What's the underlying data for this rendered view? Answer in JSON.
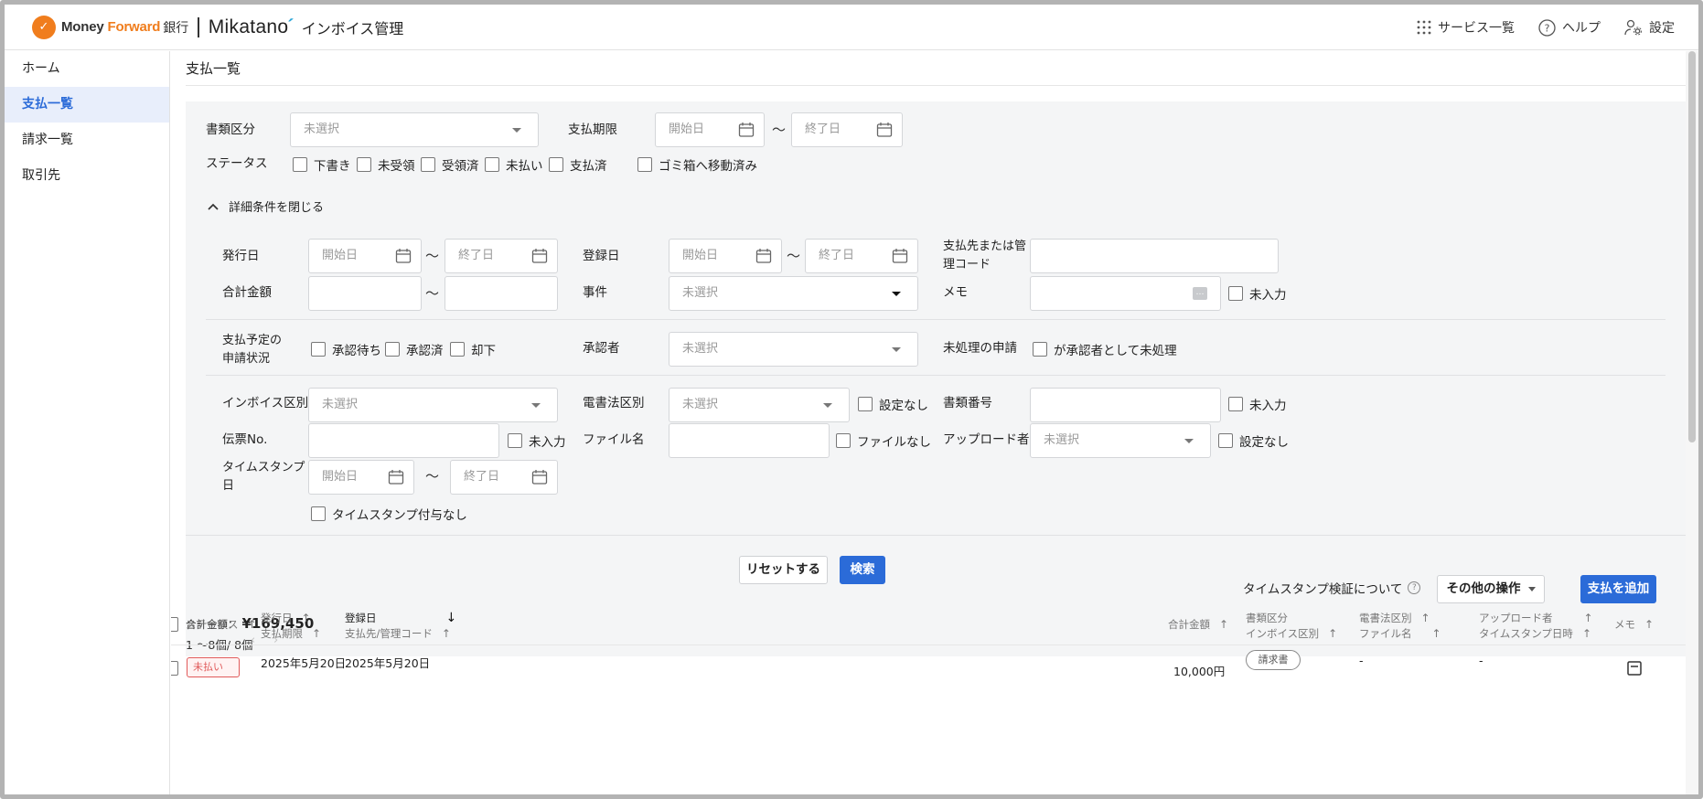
{
  "header": {
    "brand_money": "Money ",
    "brand_forward": "Forward",
    "brand_bank": "銀行",
    "brand_mikatano": "Mikatano",
    "brand_accent": "´",
    "app_title": "インボイス管理",
    "services_label": "サービス一覧",
    "help_label": "ヘルプ",
    "settings_label": "設定"
  },
  "sidebar": {
    "items": [
      {
        "label": "ホーム",
        "active": false
      },
      {
        "label": "支払一覧",
        "active": true
      },
      {
        "label": "請求一覧",
        "active": false
      },
      {
        "label": "取引先",
        "active": false
      }
    ]
  },
  "page": {
    "title": "支払一覧"
  },
  "filters": {
    "doc_type_label": "書類区分",
    "doc_type_value": "未選択",
    "due_label": "支払期限",
    "start_placeholder": "開始日",
    "end_placeholder": "終了日",
    "tilde": "〜",
    "status_label": "ステータス",
    "statuses": [
      "下書き",
      "未受領",
      "受領済",
      "未払い",
      "支払済"
    ],
    "trash_label": "ゴミ箱へ移動済み",
    "toggle_label": "詳細条件を閉じる",
    "issue_date_label": "発行日",
    "register_date_label": "登録日",
    "payee_label": "支払先または管理コード",
    "payee_line1": "支払先または管",
    "payee_line2": "理コード",
    "amount_label": "合計金額",
    "case_label": "事件",
    "case_value": "未選択",
    "memo_label": "メモ",
    "memo_icon": "…",
    "not_input_label": "未入力",
    "approval_label_1": "支払予定の",
    "approval_label_2": "申請状況",
    "approval_options": [
      "承認待ち",
      "承認済",
      "却下"
    ],
    "approver_label": "承認者",
    "approver_value": "未選択",
    "pending_label": "未処理の申請",
    "pending_option": "が承認者として未処理",
    "invoice_type_label": "インボイス区別",
    "invoice_type_value": "未選択",
    "ebook_label": "電書法区別",
    "ebook_value": "未選択",
    "no_setting_label": "設定なし",
    "doc_no_label": "書類番号",
    "slip_label": "伝票No.",
    "filename_label": "ファイル名",
    "no_file_label": "ファイルなし",
    "uploader_label": "アップロード者",
    "uploader_value": "未選択",
    "timestamp_label_1": "タイムスタンプ",
    "timestamp_label_2": "日",
    "no_timestamp_label": "タイムスタンプ付与なし"
  },
  "actions": {
    "reset": "リセットする",
    "search": "検索"
  },
  "summary": {
    "total_label": "合計金額：",
    "total_value": "¥169,450",
    "count": "1 〜8個/ 8個",
    "prev": "‹",
    "next": "›",
    "timestamp_verify": "タイムスタンプ検証について",
    "help_mark": "?",
    "other_ops": "その他の操作",
    "add_payment": "支払を追加"
  },
  "table": {
    "headers": {
      "status": "ステータス",
      "issue_date": "発行日",
      "due_date": "支払期限",
      "register_date": "登録日",
      "payee": "支払先/管理コード",
      "amount": "合計金額",
      "doc_type": "書類区分",
      "invoice_type": "インボイス区別",
      "ebook_type": "電書法区別",
      "filename": "ファイル名",
      "uploader": "アップロード者",
      "timestamp": "タイムスタンプ日時",
      "memo": "メモ"
    },
    "sort_up": "↑",
    "sort_down": "↓",
    "rows": [
      {
        "status": "未払い",
        "issue_date": "2025年5月20日",
        "register_date": "2025年5月20日",
        "amount": "10,000円",
        "doc_type": "請求書",
        "ebook": "-",
        "uploader": "-"
      }
    ]
  },
  "colors": {
    "accent": "#2b6bd8",
    "brand_orange": "#f07d1d",
    "mikatano_accent": "#2ca7d8",
    "panel_bg": "#f4f5f6",
    "unpaid_red": "#e05a5a"
  }
}
